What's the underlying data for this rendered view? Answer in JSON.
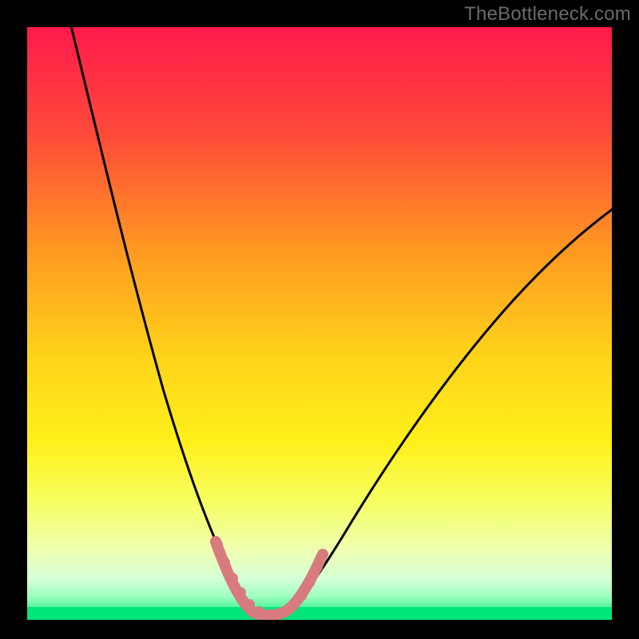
{
  "watermark": {
    "text": "TheBottleneck.com"
  },
  "colors": {
    "black": "#000000",
    "curve": "#000000",
    "highlight": "#d77b7f",
    "grad_top": "#ff1a4b",
    "grad_mid1": "#ff8a1f",
    "grad_mid2": "#ffe11a",
    "grad_low1": "#f7ff8a",
    "grad_low2": "#eaffd6",
    "grad_bottom": "#00e679"
  },
  "chart_data": {
    "type": "line",
    "title": "",
    "xlabel": "",
    "ylabel": "",
    "xlim": [
      0,
      100
    ],
    "ylim": [
      0,
      100
    ],
    "note": "Bottleneck-style V curve. y≈0 near the optimum x≈40; y rises steeply toward both ends. Values are percentage estimates read from the gradient/position.",
    "series": [
      {
        "name": "bottleneck-curve",
        "x": [
          5,
          10,
          15,
          20,
          25,
          30,
          33,
          36,
          38,
          40,
          42,
          44,
          48,
          55,
          62,
          70,
          80,
          90,
          100
        ],
        "y": [
          100,
          85,
          68,
          50,
          33,
          16,
          8,
          3,
          1,
          0,
          1,
          3,
          8,
          18,
          28,
          40,
          52,
          62,
          72
        ]
      }
    ],
    "highlight_range_x": [
      33,
      46
    ],
    "annotations": []
  }
}
